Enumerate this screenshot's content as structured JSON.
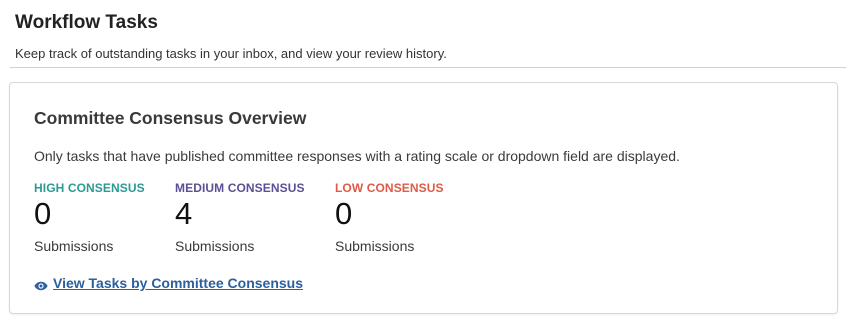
{
  "header": {
    "title": "Workflow Tasks",
    "subtitle": "Keep track of outstanding tasks in your inbox, and view your review history."
  },
  "card": {
    "title": "Committee Consensus Overview",
    "description": "Only tasks that have published committee responses with a rating scale or dropdown field are displayed.",
    "stats": [
      {
        "label": "HIGH CONSENSUS",
        "value": "0",
        "unit": "Submissions",
        "color": "#2a9a93"
      },
      {
        "label": "MEDIUM CONSENSUS",
        "value": "4",
        "unit": "Submissions",
        "color": "#5b4f96"
      },
      {
        "label": "LOW CONSENSUS",
        "value": "0",
        "unit": "Submissions",
        "color": "#e05a45"
      }
    ],
    "link": {
      "icon": "eye-icon",
      "label": "View Tasks by Committee Consensus",
      "color": "#2b5f9e"
    }
  }
}
